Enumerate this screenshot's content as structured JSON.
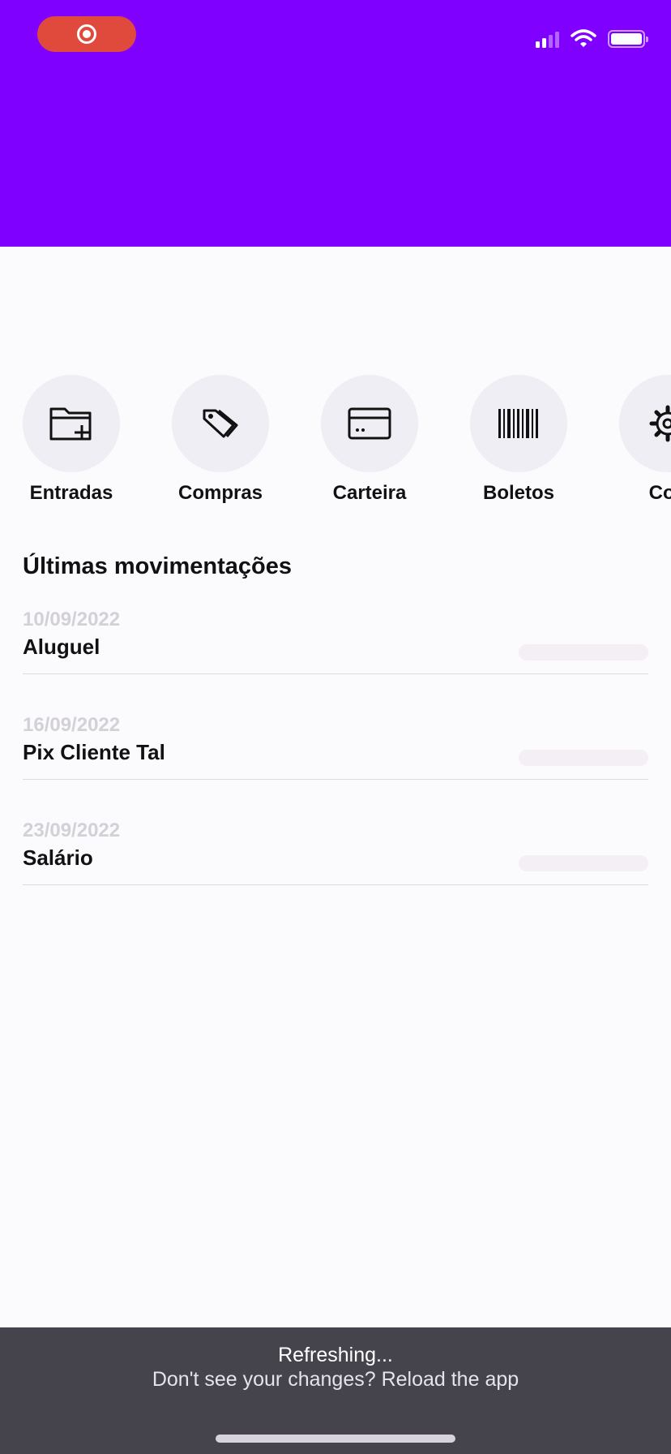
{
  "colors": {
    "header_bg": "#8000ff",
    "recording_pill": "#e04a3c",
    "shortcut_circle": "#efeef4",
    "date_text": "#d4d0d8",
    "amount_placeholder": "#f3eff5",
    "toast_bg": "#45434b"
  },
  "status_bar": {
    "recording_icon": "screen-recording-icon",
    "signal_icon": "cellular-signal-icon",
    "wifi_icon": "wifi-icon",
    "battery_icon": "battery-icon",
    "battery_level": 1.0
  },
  "shortcuts": [
    {
      "label": "Entradas",
      "icon": "folder-plus-icon"
    },
    {
      "label": "Compras",
      "icon": "tags-icon"
    },
    {
      "label": "Carteira",
      "icon": "credit-card-icon"
    },
    {
      "label": "Boletos",
      "icon": "barcode-icon"
    },
    {
      "label": "Con",
      "icon": "gear-icon"
    }
  ],
  "transactions_section": {
    "title": "Últimas movimentações",
    "items": [
      {
        "date": "10/09/2022",
        "name": "Aluguel"
      },
      {
        "date": "16/09/2022",
        "name": "Pix Cliente Tal"
      },
      {
        "date": "23/09/2022",
        "name": "Salário"
      }
    ]
  },
  "toast": {
    "line1": "Refreshing...",
    "line2": "Don't see your changes? Reload the app"
  }
}
